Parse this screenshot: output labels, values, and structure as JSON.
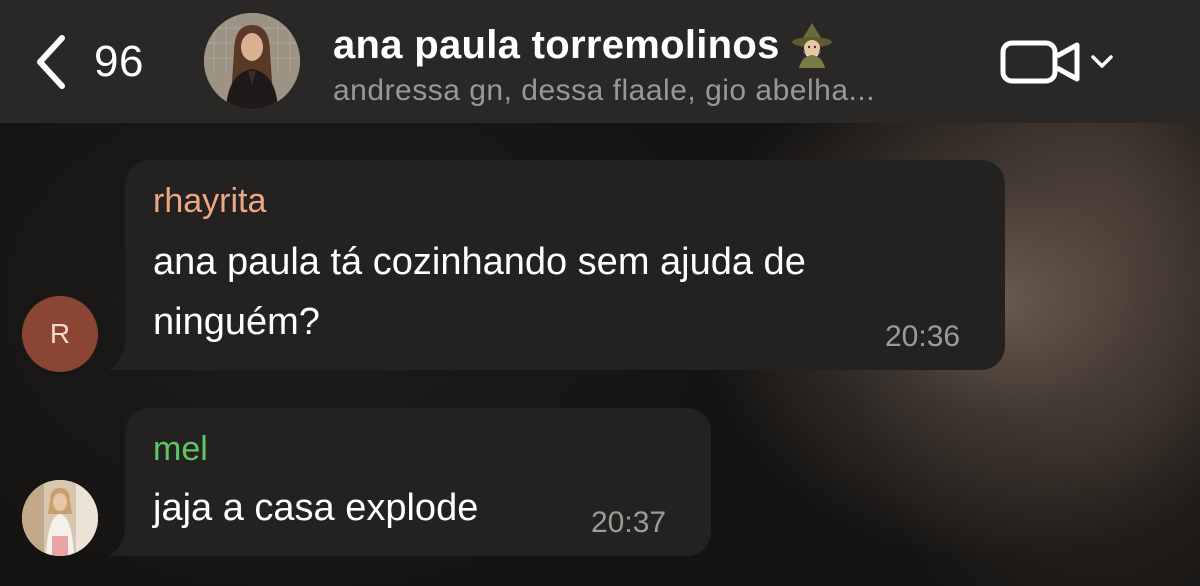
{
  "header": {
    "back_count": "96",
    "title": "ana paula torremolinos",
    "title_emoji": "mage-emoji",
    "subtitle": "andressa gn, dessa flaale, gio abelha...",
    "video_icon": "video-camera-icon",
    "dropdown_icon": "chevron-down-icon"
  },
  "messages": [
    {
      "sender": "rhayrita",
      "sender_color": "#f0a583",
      "avatar_initial": "R",
      "avatar_color": "#8a4535",
      "text_line1": "ana paula tá cozinhando sem ajuda de",
      "text_line2": "ninguém?",
      "time": "20:36"
    },
    {
      "sender": "mel",
      "sender_color": "#62c463",
      "text": "jaja a casa explode",
      "time": "20:37"
    }
  ],
  "colors": {
    "header_bg": "#2a2827",
    "bubble_bg": "#232221",
    "text": "#ffffff",
    "muted": "#9a9896"
  }
}
